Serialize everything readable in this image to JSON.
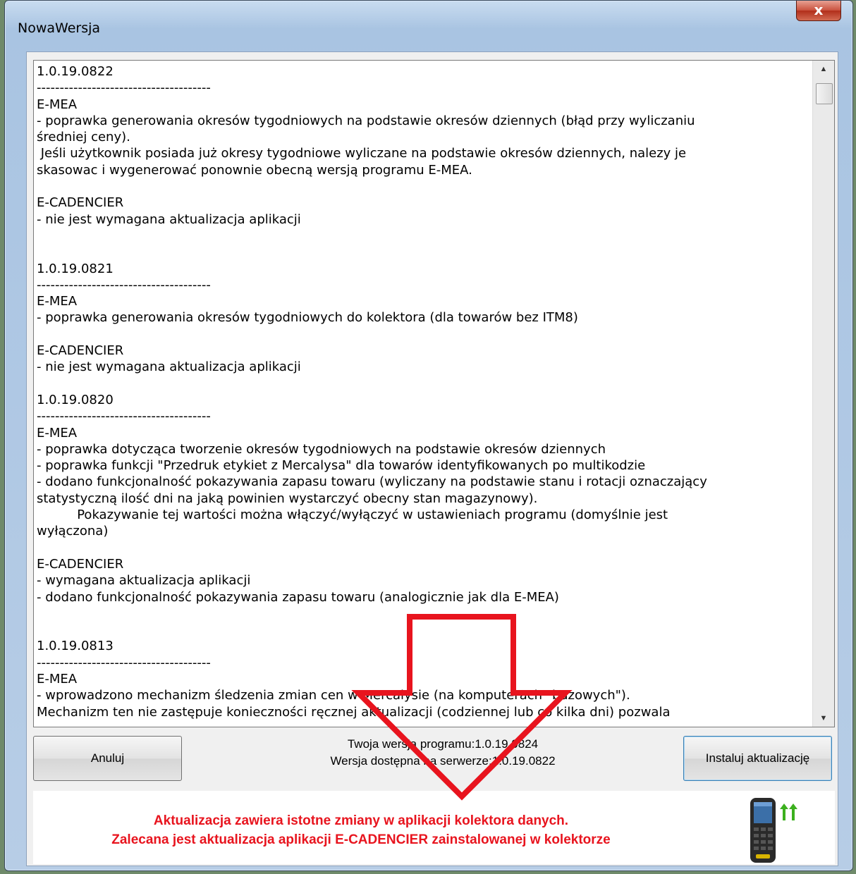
{
  "window": {
    "title": "NowaWersja",
    "close_label": "x"
  },
  "changelog": {
    "lines": [
      "1.0.19.0822",
      "--------------------------------------",
      "E-MEA",
      "- poprawka generowania okresów tygodniowych na podstawie okresów dziennych (błąd przy wyliczaniu",
      "średniej ceny).",
      " Jeśli użytkownik posiada już okresy tygodniowe wyliczane na podstawie okresów dziennych, nalezy je",
      "skasowac i wygenerować ponownie obecną wersją programu E-MEA.",
      "",
      "E-CADENCIER",
      "- nie jest wymagana aktualizacja aplikacji",
      "",
      "",
      "1.0.19.0821",
      "--------------------------------------",
      "E-MEA",
      "- poprawka generowania okresów tygodniowych do kolektora (dla towarów bez ITM8)",
      "",
      "E-CADENCIER",
      "- nie jest wymagana aktualizacja aplikacji",
      "",
      "1.0.19.0820",
      "--------------------------------------",
      "E-MEA",
      "- poprawka dotycząca tworzenie okresów tygodniowych na podstawie okresów dziennych",
      "- poprawka funkcji \"Przedruk etykiet z Mercalysa\" dla towarów identyfikowanych po multikodzie",
      "- dodano funkcjonalność pokazywania zapasu towaru (wyliczany na podstawie stanu i rotacji oznaczający",
      "statystyczną ilość dni na jaką powinien wystarczyć obecny stan magazynowy).",
      "          Pokazywanie tej wartości można włączyć/wyłączyć w ustawieniach programu (domyślnie jest",
      "wyłączona)",
      "",
      "E-CADENCIER",
      "- wymagana aktualizacja aplikacji",
      "- dodano funkcjonalność pokazywania zapasu towaru (analogicznie jak dla E-MEA)",
      "",
      "",
      "1.0.19.0813",
      "--------------------------------------",
      "E-MEA",
      "- wprowadzono mechanizm śledzenia zmian cen w Mercalysie (na komputerach \"bazowych\").",
      "Mechanizm ten nie zastępuje konieczności ręcznej aktualizacji (codziennej lub co kilka dni) pozwala"
    ]
  },
  "buttons": {
    "cancel": "Anuluj",
    "install": "Instaluj aktualizację"
  },
  "versions": {
    "current": "Twoja wersja programu:1.0.19.0824",
    "server": "Wersja dostępna na serwerze:1.0.19.0822"
  },
  "notice": {
    "line1": "Aktualizacja zawiera istotne zmiany w aplikacji kolektora danych.",
    "line2": "Zalecana jest aktualizacja aplikacji E-CADENCIER zainstalowanej w kolektorze",
    "color": "#e8141e"
  },
  "annotation": {
    "arrow_color": "#e8141e"
  },
  "icons": {
    "device": "handheld-scanner-icon",
    "update": "upload-arrows-icon"
  }
}
